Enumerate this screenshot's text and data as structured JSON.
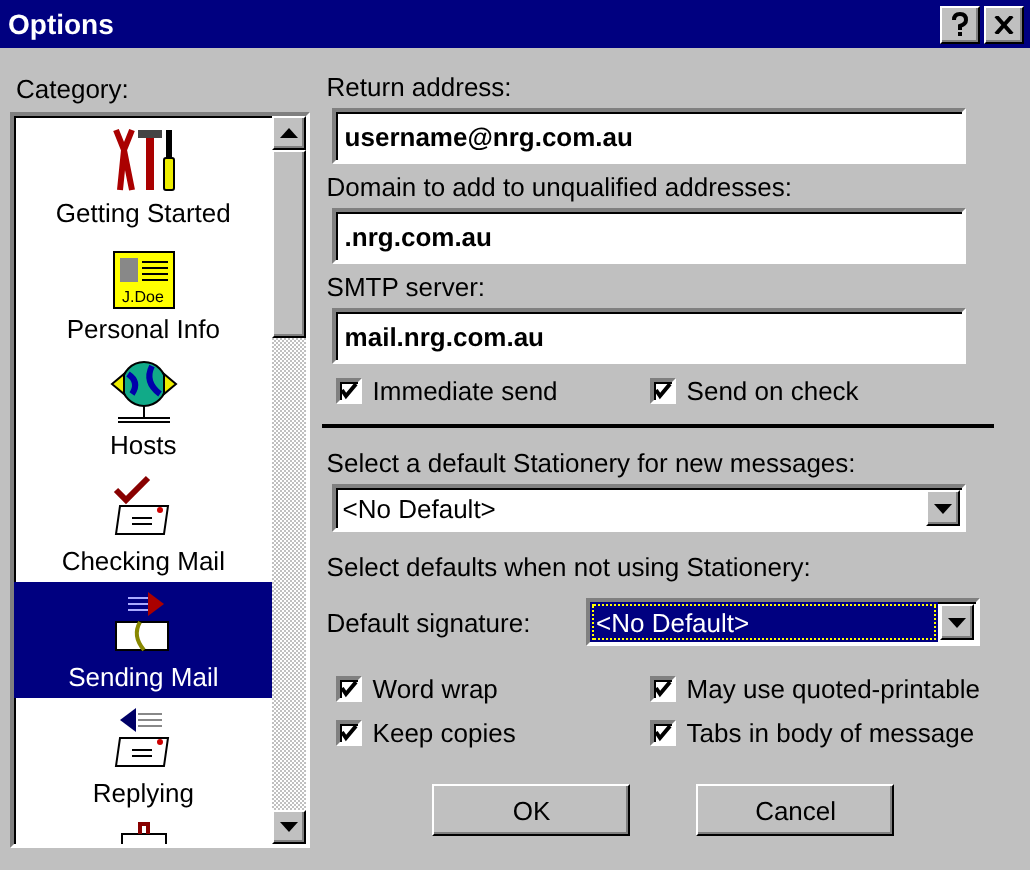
{
  "window": {
    "title": "Options"
  },
  "category": {
    "label": "Category:",
    "items": [
      {
        "kind": "tools",
        "label": "Getting Started",
        "selected": false
      },
      {
        "kind": "card",
        "label": "Personal Info",
        "badge": "J.Doe",
        "selected": false
      },
      {
        "kind": "globe",
        "label": "Hosts",
        "selected": false
      },
      {
        "kind": "check",
        "label": "Checking Mail",
        "selected": false
      },
      {
        "kind": "send",
        "label": "Sending Mail",
        "selected": true
      },
      {
        "kind": "reply",
        "label": "Replying",
        "selected": false
      }
    ]
  },
  "fields": [
    {
      "label": "Return address:",
      "value": "username@nrg.com.au"
    },
    {
      "label": "Domain to add to unqualified addresses:",
      "value": ".nrg.com.au"
    },
    {
      "label": "SMTP server:",
      "value": "mail.nrg.com.au"
    }
  ],
  "send_options": [
    {
      "label": "Immediate send",
      "checked": true
    },
    {
      "label": "Send on check",
      "checked": true
    }
  ],
  "stationery": {
    "label": "Select a default Stationery for new messages:",
    "value": "<No Default>"
  },
  "defaults": {
    "label": "Select defaults when not using Stationery:",
    "signature_label": "Default signature:",
    "signature_value": "<No Default>",
    "focused": true
  },
  "options": [
    {
      "label": "Word wrap",
      "checked": true
    },
    {
      "label": "May use quoted-printable",
      "checked": true
    },
    {
      "label": "Keep copies",
      "checked": true
    },
    {
      "label": "Tabs in body of message",
      "checked": true
    }
  ],
  "buttons": [
    "OK",
    "Cancel"
  ]
}
